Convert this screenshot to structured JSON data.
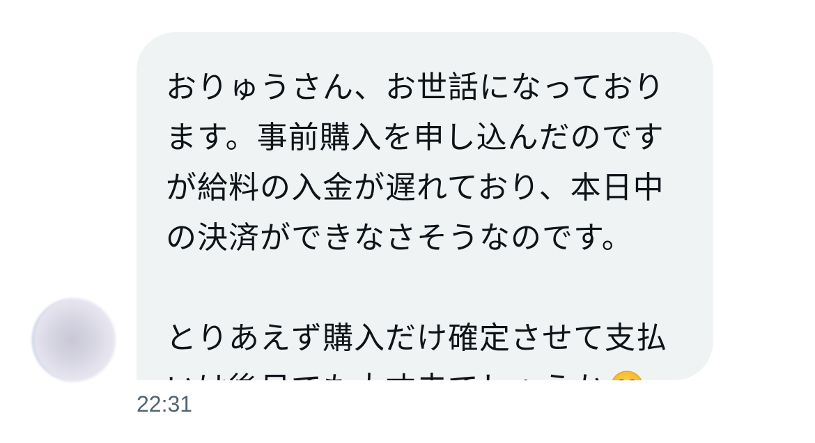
{
  "message": {
    "lines": [
      "おりゅうさん、お世話になっており",
      "ます。事前購入を申し込んだのです",
      "が給料の入金が遅れており、本日中",
      "の決済ができなさそうなのです。",
      "",
      "とりあえず購入だけ確定させて支払",
      "いは後日でも大丈夫でしょうか"
    ],
    "emoji": "sad-but-relieved-face-icon",
    "timestamp": "22:31"
  },
  "colors": {
    "bubble_background": "#eff3f4",
    "text": "#0f1419",
    "timestamp": "#536471"
  }
}
